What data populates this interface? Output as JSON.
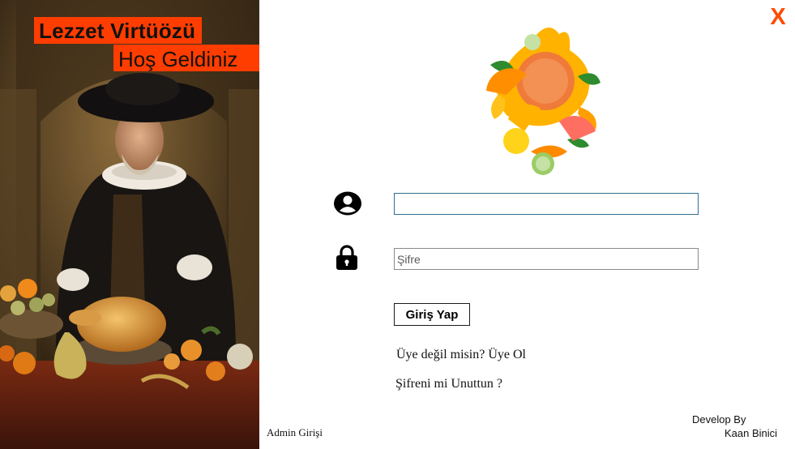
{
  "window": {
    "close_label": "X",
    "accent_color": "#ff4a00"
  },
  "banner": {
    "title": "Lezzet Virtüözü",
    "welcome": "Hoş Geldiniz"
  },
  "icons": {
    "user": "user-circle-icon",
    "lock": "lock-icon",
    "logo": "fruit-splash-logo"
  },
  "form": {
    "username_value": "",
    "password_placeholder": "Şifre",
    "login_label": "Giriş Yap",
    "signup_link": "Üye değil misin? Üye Ol",
    "forgot_link": "Şifreni mi Unuttun ?",
    "admin_link": "Admin Girişi"
  },
  "credits": {
    "label": "Develop By",
    "name": "Kaan Binici"
  }
}
